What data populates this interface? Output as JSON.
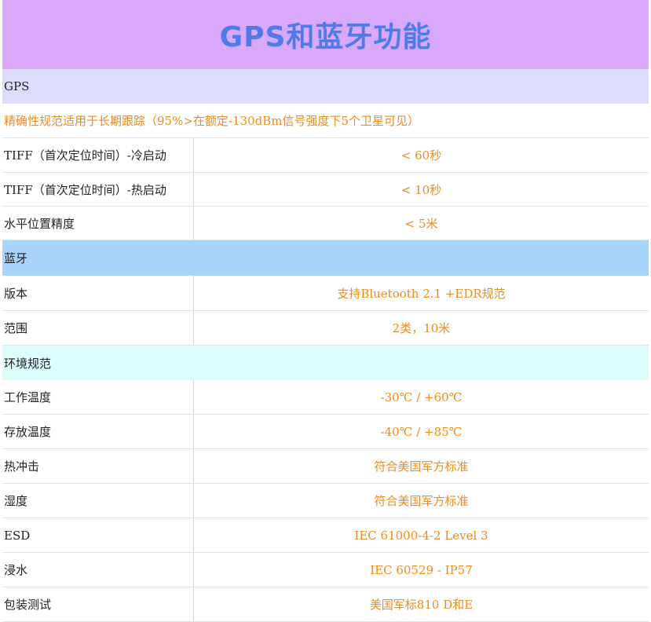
{
  "title": "GPS和蓝牙功能",
  "sections": {
    "gps": {
      "header": "GPS",
      "note": "精确性规范适用于长期跟踪（95%>在额定-130dBm信号强度下5个卫星可见）",
      "rows": [
        {
          "label": "TIFF（首次定位时间）-冷启动",
          "value": "< 60秒"
        },
        {
          "label": "TIFF（首次定位时间）-热启动",
          "value": "< 10秒"
        },
        {
          "label": "水平位置精度",
          "value": "< 5米"
        }
      ]
    },
    "bluetooth": {
      "header": "蓝牙",
      "rows": [
        {
          "label": "版本",
          "value": "支持Bluetooth 2.1 +EDR规范"
        },
        {
          "label": "范围",
          "value": "2类，10米"
        }
      ]
    },
    "environment": {
      "header": "环境规范",
      "rows": [
        {
          "label": "工作温度",
          "value": "-30℃ / +60℃"
        },
        {
          "label": "存放温度",
          "value": "-40℃ / +85℃"
        },
        {
          "label": "热冲击",
          "value": "符合美国军方标准"
        },
        {
          "label": "湿度",
          "value": "符合美国军方标准"
        },
        {
          "label": "ESD",
          "value": "IEC 61000-4-2 Level 3"
        },
        {
          "label": "浸水",
          "value": "IEC 60529 - IP57"
        },
        {
          "label": "包装测试",
          "value": "美国军标810 D和E"
        }
      ]
    }
  },
  "colors": {
    "title_bg": "#d9a8fb",
    "title_text": "#4f7be8",
    "gps_header_bg": "#dedcfd",
    "bluetooth_header_bg": "#a8d4fb",
    "environment_header_bg": "#dcfbfb",
    "value_text": "#f08a1c"
  }
}
